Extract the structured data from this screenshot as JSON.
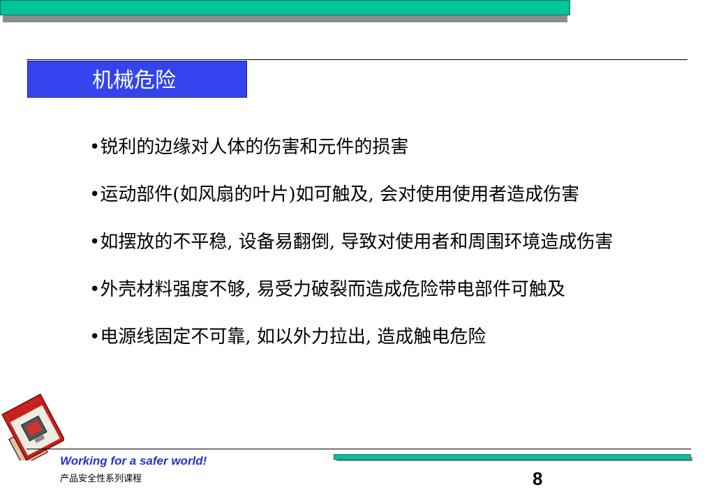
{
  "slide": {
    "title": "机械危险",
    "bullets": [
      "锐利的边缘对人体的伤害和元件的损害",
      "运动部件(如风扇的叶片)如可触及, 会对使用使用者造成伤害",
      "如摆放的不平稳, 设备易翻倒, 导致对使用者和周围环境造成伤害",
      "外壳材料强度不够, 易受力破裂而造成危险带电部件可触及",
      "电源线固定不可靠, 如以外力拉出, 造成触电危险"
    ]
  },
  "footer": {
    "tagline": "Working for a safer world!",
    "course": "产品安全性系列课程",
    "page_number": "8",
    "icon": "operation-manual-icon"
  },
  "colors": {
    "accent_teal": "#00c49a",
    "title_blue": "#3344ee",
    "tagline_blue": "#2233cc"
  }
}
